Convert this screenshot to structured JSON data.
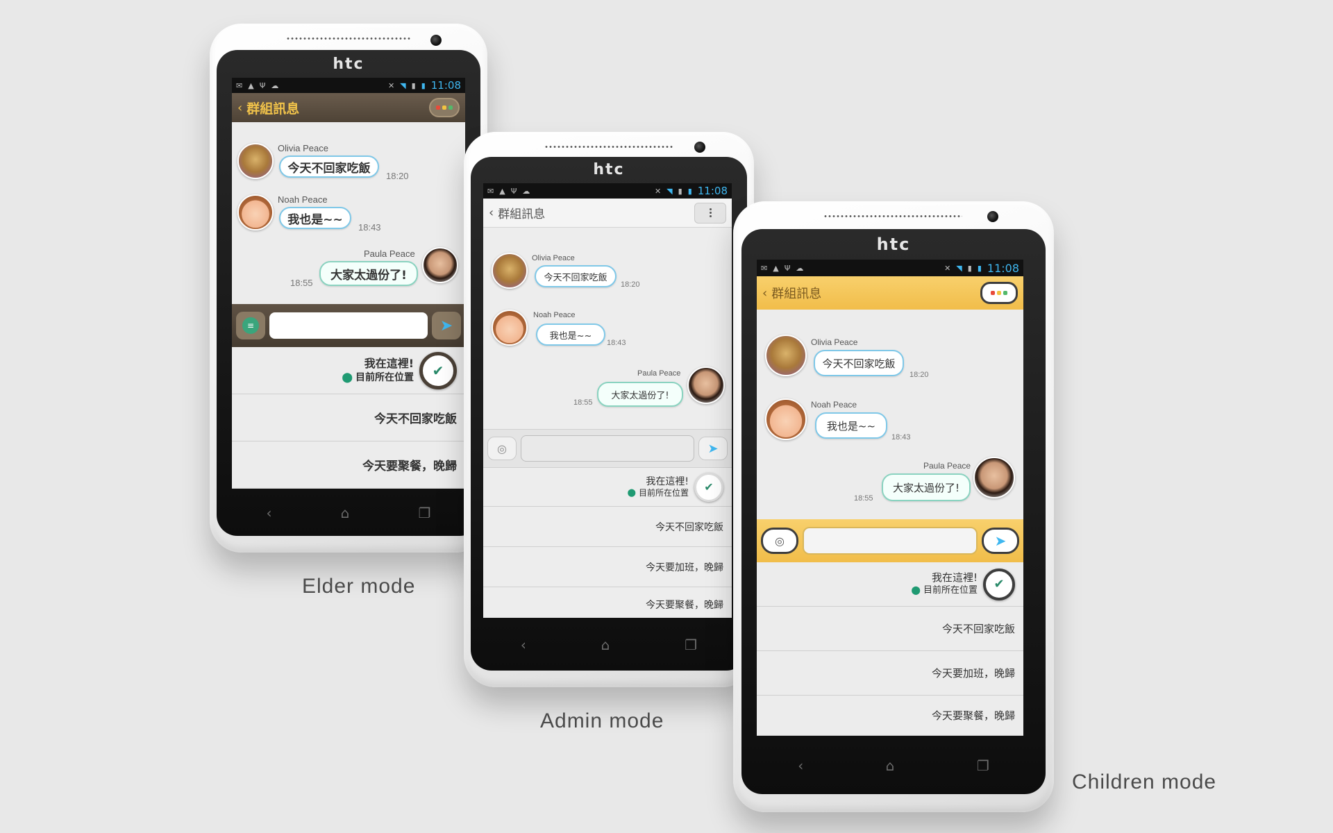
{
  "brand": "htc",
  "status": {
    "time": "11:08"
  },
  "header_title": "群組訊息",
  "messages": [
    {
      "name": "Olivia Peace",
      "text": "今天不回家吃飯",
      "time": "18:20"
    },
    {
      "name": "Noah Peace",
      "text": "我也是~~",
      "time": "18:43"
    },
    {
      "name": "Paula Peace",
      "text": "大家太過份了!",
      "time": "18:55"
    }
  ],
  "location": {
    "title": "我在這裡!",
    "subtitle": "目前所在位置"
  },
  "quick_replies": {
    "not_home": "今天不回家吃飯",
    "overtime": "今天要加班，晚歸",
    "dinner": "今天要聚餐，晚歸"
  },
  "captions": {
    "elder": "Elder mode",
    "admin": "Admin mode",
    "children": "Children mode"
  },
  "colors": {
    "elder_header": "#5b4e41",
    "admin_header": "#f4f4f4",
    "children_header": "#f6c75a",
    "status_time": "#3fb7f0",
    "bubble_border": "#7fc8e8"
  }
}
